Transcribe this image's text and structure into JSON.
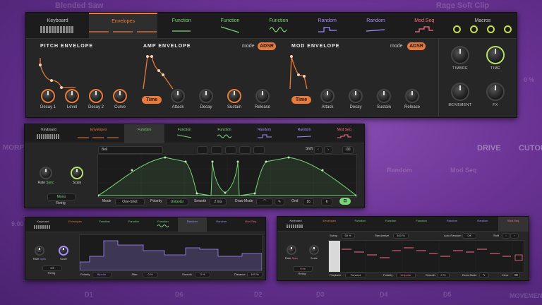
{
  "background_labels": {
    "top_left": "Blended Saw",
    "top_right": "Rage Soft Clip",
    "morph": "MORP",
    "drive": "DRIVE",
    "cutoff": "CUTOFF",
    "random": "Random",
    "modseq": "Mod Seq",
    "movement": "MOVEMEN",
    "d1": "D1",
    "d2": "D2",
    "d3": "D3",
    "d4": "D4",
    "d5": "D5",
    "d6": "D6",
    "pct": "0 %",
    "val": "9.00"
  },
  "panel1": {
    "tabs": [
      {
        "label": "Keyboard"
      },
      {
        "label": "Envelopes"
      },
      {
        "label": "Function"
      },
      {
        "label": "Function"
      },
      {
        "label": "Function"
      },
      {
        "label": "Random"
      },
      {
        "label": "Random"
      },
      {
        "label": "Mod Seq"
      },
      {
        "label": "Macros"
      }
    ],
    "pitch": {
      "title": "PITCH ENVELOPE",
      "knobs": [
        "Decay 1",
        "Level",
        "Decay 2",
        "Curve"
      ]
    },
    "amp": {
      "title": "AMP ENVELOPE",
      "mode_label": "mode",
      "mode_value": "ADSR",
      "time_label": "Time",
      "knobs": [
        "Attack",
        "Decay",
        "Sustain",
        "Release"
      ]
    },
    "mod": {
      "title": "MOD ENVELOPE",
      "mode_label": "mode",
      "mode_value": "ADSR",
      "time_label": "Time",
      "knobs": [
        "Attack",
        "Decay",
        "Sustain",
        "Release"
      ]
    },
    "macros": [
      "TIMBRE",
      "TIME",
      "MOVEMENT",
      "FX"
    ]
  },
  "panel2": {
    "tabs": [
      "Keyboard",
      "Envelopes",
      "Function",
      "Function",
      "Function",
      "Random",
      "Random",
      "Mod Seq"
    ],
    "preset": "Bell",
    "shift_label": "Shift",
    "rate_label": "Rate",
    "sync_label": "Sync",
    "scale_label": "Scale",
    "mono_label": "Mono",
    "retrig_label": "Retrig",
    "mode_label": "Mode",
    "mode_value": "One-Shot",
    "polarity_label": "Polarity",
    "polarity_value": "Unipolar",
    "smooth_label": "Smooth",
    "smooth_value": "2 ms",
    "drawmode_label": "Draw Mode",
    "grid_label": "Grid",
    "grid_x": "16",
    "grid_y": "6"
  },
  "panel3": {
    "tabs": [
      "Keyboard",
      "Envelopes",
      "Function",
      "Function",
      "Function",
      "Random",
      "Random",
      "Mod Seq"
    ],
    "rate_label": "Rate",
    "sync_label": "Sync",
    "scale_label": "Scale",
    "off_label": "Off",
    "retrig_label": "Retrig",
    "polarity_label": "Polarity",
    "polarity_value": "Bipolar",
    "jitter_label": "Jitter",
    "jitter_value": "0 %",
    "smooth_label": "Smooth",
    "smooth_value": "0 %",
    "distance_label": "Distance",
    "distance_value": "100 %"
  },
  "panel4": {
    "tabs": [
      "Keyboard",
      "Envelopes",
      "Function",
      "Function",
      "Function",
      "Random",
      "Random",
      "Mod Seq"
    ],
    "swing_label": "Swing",
    "swing_value": "50 %",
    "randomize_label": "Randomize",
    "randomize_value": "100 %",
    "auto_random_label": "Auto Random",
    "auto_random_value": "Off",
    "shift_label": "Shift",
    "rate_label": "Rate",
    "sync_label": "Sync",
    "scale_label": "Scale",
    "free_label": "Free",
    "retrig_label": "Retrig",
    "playback_label": "Playback",
    "playback_value": "Forward",
    "polarity_label": "Polarity",
    "polarity_value": "Unipolar",
    "smooth_label": "Smooth",
    "smooth_value": "0 %",
    "drawmode_label": "Draw Mode",
    "clear_label": "Clear"
  },
  "colors": {
    "accent_orange": "#e87a3a",
    "accent_green": "#7bd67b",
    "accent_purple": "#a58cff",
    "accent_pink": "#ff6b8a",
    "macro_yellow": "#c7e04a"
  }
}
